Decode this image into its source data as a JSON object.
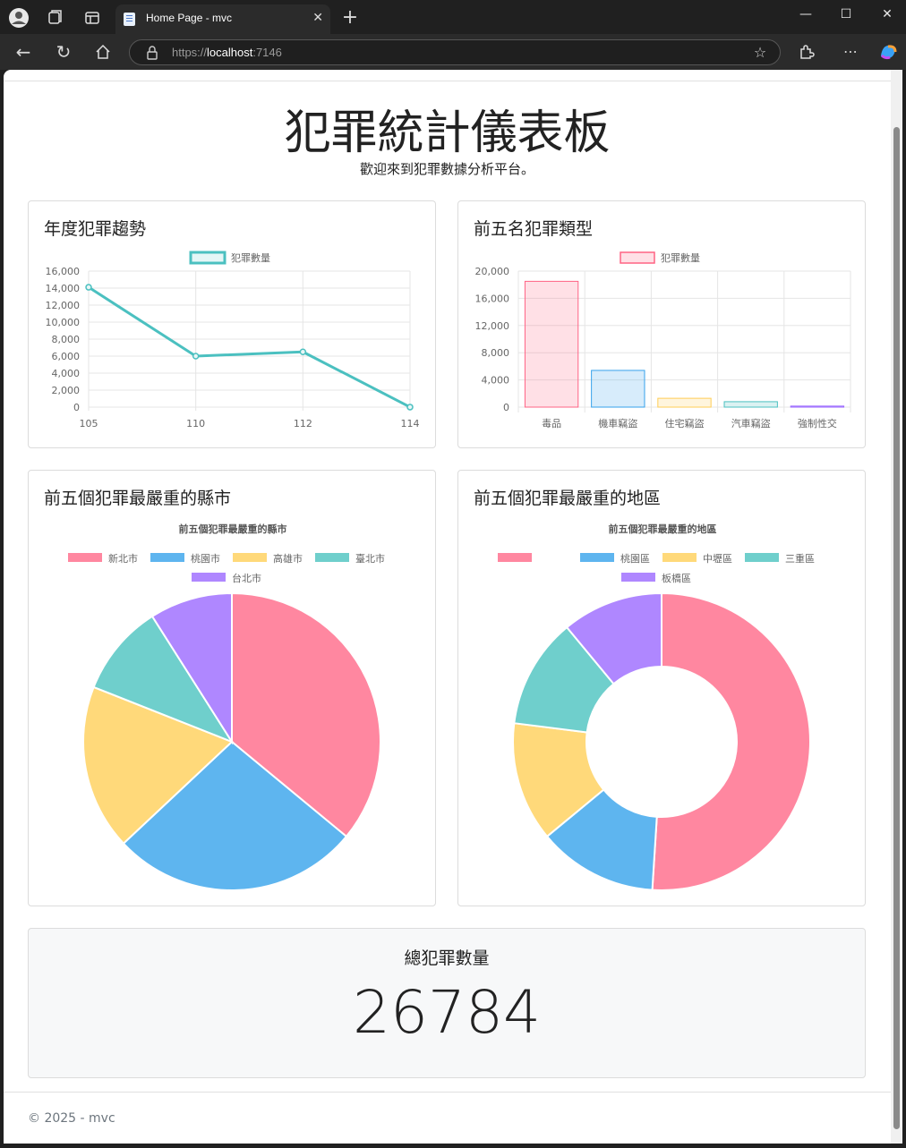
{
  "browser": {
    "tab_title": "Home Page - mvc",
    "url_prefix": "https://",
    "url_host": "localhost",
    "url_port": ":7146"
  },
  "page": {
    "title": "犯罪統計儀表板",
    "subtitle": "歡迎來到犯罪數據分析平台。",
    "total_label": "總犯罪數量",
    "total_value": "26784",
    "footer": "© 2025 - mvc"
  },
  "cards": {
    "trend": "年度犯罪趨勢",
    "types": "前五名犯罪類型",
    "cities": "前五個犯罪最嚴重的縣市",
    "districts": "前五個犯罪最嚴重的地區"
  },
  "chart_data": [
    {
      "type": "line",
      "x": [
        "105",
        "110",
        "112",
        "114"
      ],
      "series": [
        {
          "name": "犯罪數量",
          "values": [
            14100,
            6000,
            6500,
            5
          ]
        }
      ],
      "ylim": [
        0,
        16000
      ],
      "yticks": [
        "16,000",
        "14,000",
        "12,000",
        "10,000",
        "8,000",
        "6,000",
        "4,000",
        "2,000",
        "0"
      ],
      "color": "#4bc0c0"
    },
    {
      "type": "bar",
      "categories": [
        "毒品",
        "機車竊盜",
        "住宅竊盜",
        "汽車竊盜",
        "強制性交"
      ],
      "series": [
        {
          "name": "犯罪數量",
          "values": [
            18500,
            5400,
            1300,
            800,
            150
          ]
        }
      ],
      "ylim": [
        0,
        20000
      ],
      "yticks": [
        "20,000",
        "16,000",
        "12,000",
        "8,000",
        "4,000",
        "0"
      ],
      "colors": [
        "#ff6384",
        "#36a2eb",
        "#ffce56",
        "#4bc0c0",
        "#9966ff"
      ]
    },
    {
      "type": "pie",
      "title": "前五個犯罪最嚴重的縣市",
      "labels": [
        "新北市",
        "桃園市",
        "高雄市",
        "臺北市",
        "台北市"
      ],
      "values": [
        36,
        27,
        18,
        10,
        9
      ],
      "colors": [
        "#ff87a0",
        "#5eb5ef",
        "#ffd97a",
        "#6fcfcc",
        "#af87ff"
      ]
    },
    {
      "type": "pie",
      "title": "前五個犯罪最嚴重的地區",
      "labels": [
        "",
        "桃園區",
        "中壢區",
        "三重區",
        "板橋區"
      ],
      "values": [
        51,
        13,
        13,
        12,
        11
      ],
      "colors": [
        "#ff87a0",
        "#5eb5ef",
        "#ffd97a",
        "#6fcfcc",
        "#af87ff"
      ],
      "doughnut": true
    }
  ]
}
